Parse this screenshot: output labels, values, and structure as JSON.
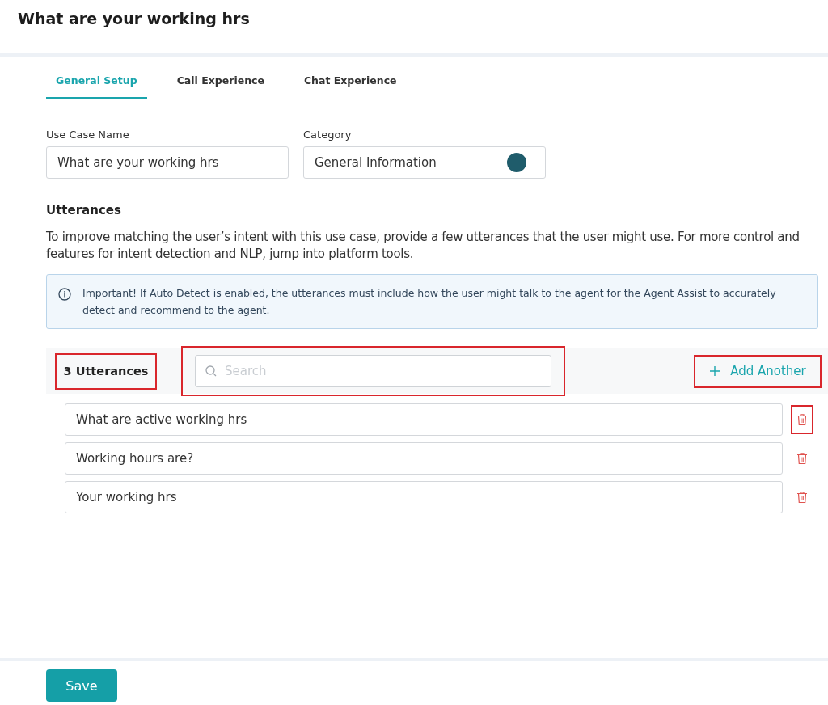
{
  "page": {
    "title": "What are your working hrs"
  },
  "tabs": [
    {
      "label": "General Setup",
      "selected": true
    },
    {
      "label": "Call Experience",
      "selected": false
    },
    {
      "label": "Chat Experience",
      "selected": false
    }
  ],
  "fields": {
    "use_case_name": {
      "label": "Use Case Name",
      "value": "What are your working hrs"
    },
    "category": {
      "label": "Category",
      "value": "General Information",
      "color": "#1f5c6b"
    }
  },
  "utterances": {
    "heading": "Utterances",
    "description": "To improve matching the user’s intent with this use case, provide a few utterances that the user might use. For more control and features for intent detection and NLP, jump into platform tools.",
    "notice": "Important! If Auto Detect is enabled, the utterances must include how the user might talk to the agent for the Agent Assist to accurately detect and recommend to the agent.",
    "count": {
      "label": "3 Utterances",
      "highlighted": true
    },
    "search": {
      "placeholder": "Search",
      "highlighted": true
    },
    "add": {
      "label": "Add Another",
      "highlighted": true
    },
    "items": [
      {
        "text": "What are active working hrs",
        "highlighted": true
      },
      {
        "text": "Working hours are?",
        "highlighted": false
      },
      {
        "text": "Your working hrs",
        "highlighted": false
      }
    ]
  },
  "footer": {
    "save": "Save"
  }
}
